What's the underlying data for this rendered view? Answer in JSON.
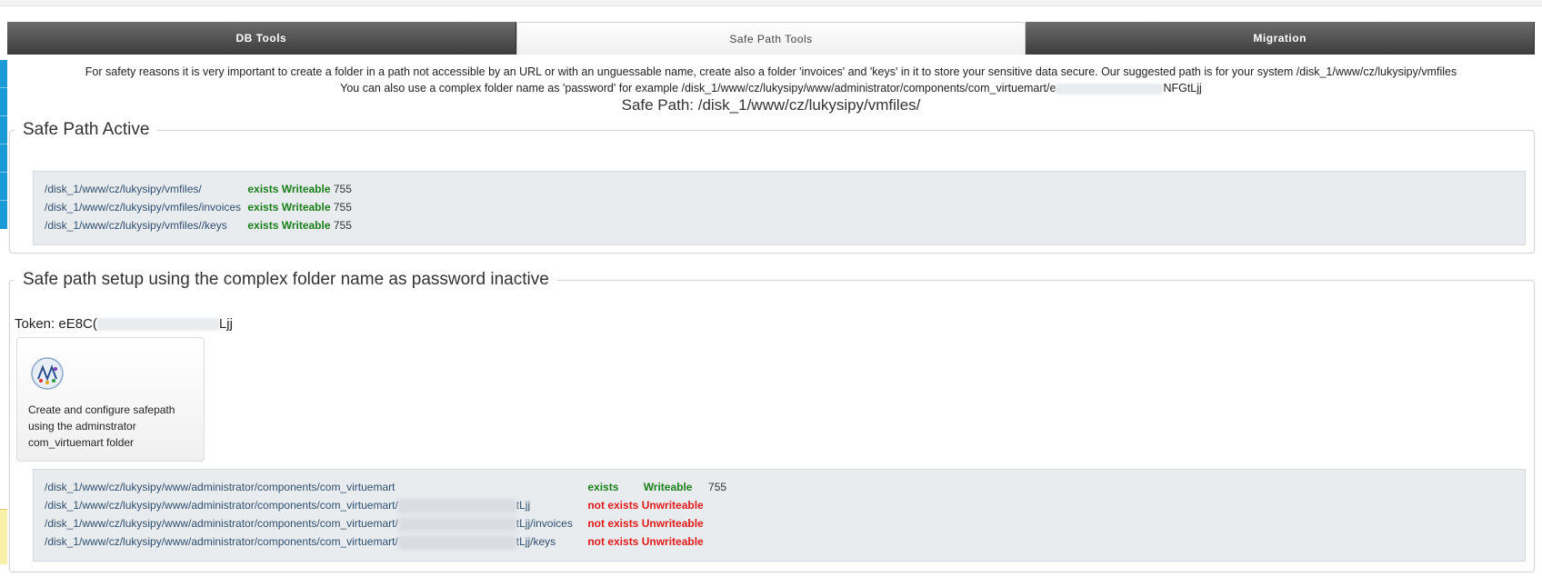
{
  "tabs": [
    {
      "label": "DB Tools",
      "active": false
    },
    {
      "label": "Safe Path Tools",
      "active": true
    },
    {
      "label": "Migration",
      "active": false
    }
  ],
  "info": {
    "line1": "For safety reasons it is very important to create a folder in a path not accessible by an URL or with an unguessable name, create also a folder 'invoices' and 'keys' in it to store your sensitive data secure. Our suggested path is for your system /disk_1/www/cz/lukysipy/vmfiles",
    "line2_prefix": "You can also use a complex folder name as 'password' for example /disk_1/www/cz/lukysipy/www/administrator/components/com_virtuemart/e",
    "line2_suffix": "NFGtLjj",
    "safe_path": "Safe Path: /disk_1/www/cz/lukysipy/vmfiles/"
  },
  "active_section": {
    "legend": "Safe Path Active",
    "rows": [
      {
        "path": "/disk_1/www/cz/lukysipy/vmfiles/",
        "exists": "exists",
        "writeable": "Writeable",
        "perm": "755"
      },
      {
        "path": "/disk_1/www/cz/lukysipy/vmfiles/invoices",
        "exists": "exists",
        "writeable": "Writeable",
        "perm": "755"
      },
      {
        "path": "/disk_1/www/cz/lukysipy/vmfiles//keys",
        "exists": "exists",
        "writeable": "Writeable",
        "perm": "755"
      }
    ]
  },
  "complex_section": {
    "legend": "Safe path setup using the complex folder name as password inactive",
    "token_prefix": "Token: eE8C(",
    "token_suffix": "Ljj",
    "card_text": "Create and configure safepath using the adminstrator com_virtuemart folder",
    "rows": [
      {
        "path": "/disk_1/www/cz/lukysipy/www/administrator/components/com_virtuemart",
        "blurred": false,
        "suffix": "",
        "exists": "exists",
        "writeable": "Writeable",
        "perm": "755"
      },
      {
        "path": "/disk_1/www/cz/lukysipy/www/administrator/components/com_virtuemart/",
        "blurred": true,
        "suffix": "tLjj",
        "exists": "not exists",
        "writeable": "Unwriteable",
        "perm": ""
      },
      {
        "path": "/disk_1/www/cz/lukysipy/www/administrator/components/com_virtuemart/",
        "blurred": true,
        "suffix": "tLjj/invoices",
        "exists": "not exists",
        "writeable": "Unwriteable",
        "perm": ""
      },
      {
        "path": "/disk_1/www/cz/lukysipy/www/administrator/components/com_virtuemart/",
        "blurred": true,
        "suffix": "tLjj/keys",
        "exists": "not exists",
        "writeable": "Unwriteable",
        "perm": ""
      }
    ]
  },
  "colors": {
    "ok": "#1a7f1a",
    "error": "#e01b1b",
    "tab_dark": "#4a4a4a",
    "accent": "#1a9ad6"
  }
}
